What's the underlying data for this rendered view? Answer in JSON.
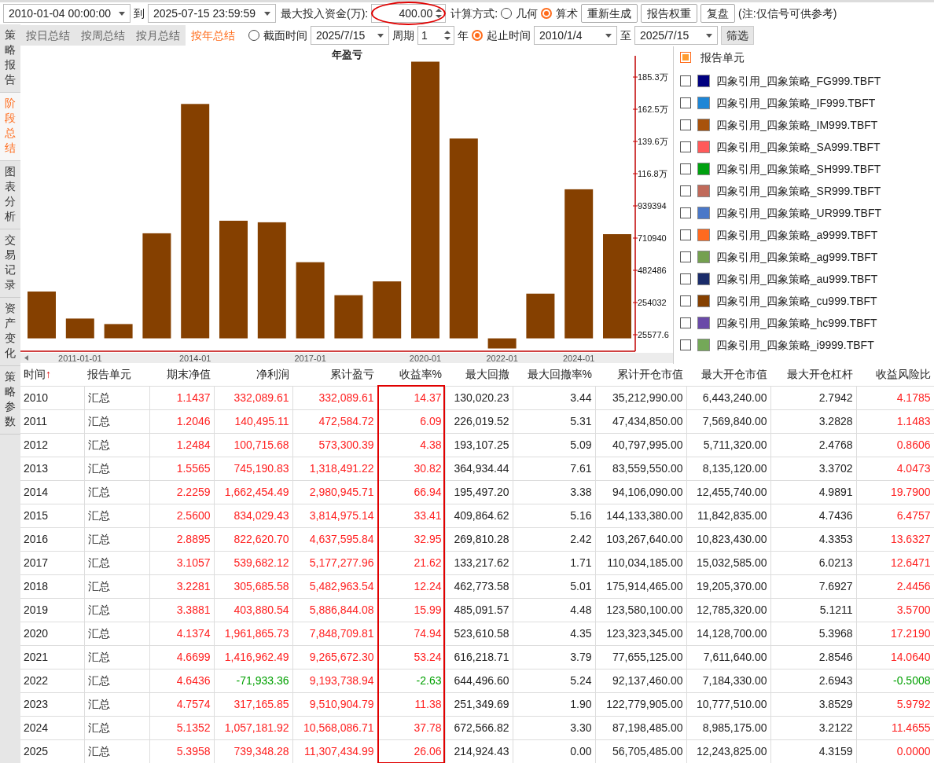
{
  "toolbar": {
    "start_time": "2010-01-04 00:00:00",
    "to_label": "到",
    "end_time": "2025-07-15 23:59:59",
    "capital_label": "最大投入资金(万):",
    "capital": {
      "value": "400.00",
      "circled": true
    },
    "method_label": "计算方式:",
    "methods": [
      {
        "label": "几何",
        "selected": false
      },
      {
        "label": "算术",
        "selected": true
      }
    ],
    "buttons": [
      "重新生成",
      "报告权重",
      "复盘"
    ],
    "note": "(注:仅信号可供参考)"
  },
  "side_tabs": [
    {
      "label": "策略报告",
      "selected": false
    },
    {
      "label": "阶段总结",
      "selected": true
    },
    {
      "label": "图表分析",
      "selected": false
    },
    {
      "label": "交易记录",
      "selected": false
    },
    {
      "label": "资产变化",
      "selected": false
    },
    {
      "label": "策略参数",
      "selected": false
    }
  ],
  "period_tabs": [
    {
      "label": "按日总结",
      "selected": false
    },
    {
      "label": "按周总结",
      "selected": false
    },
    {
      "label": "按月总结",
      "selected": false
    },
    {
      "label": "按年总结",
      "selected": true
    }
  ],
  "filter": {
    "snapshot": {
      "label": "截面时间",
      "selected": false
    },
    "snapshot_date": "2025/7/15",
    "period_label": "周期",
    "period": "1",
    "unit_label": "年",
    "range": {
      "label": "起止时间",
      "selected": true
    },
    "range_start": "2010/1/4",
    "range_to": "至",
    "range_end": "2025/7/15",
    "button": "筛选"
  },
  "chart_data": {
    "type": "bar",
    "title": "年盈亏",
    "categories": [
      null,
      "2011-01-01",
      null,
      null,
      "2014-01",
      null,
      null,
      "2017-01",
      null,
      null,
      "2020-01",
      null,
      "2022-01",
      null,
      "2024-01",
      null
    ],
    "series": [
      {
        "color": "#854000",
        "values": [
          332000,
          140000,
          101000,
          745000,
          1662000,
          834000,
          823000,
          540000,
          306000,
          404000,
          1962000,
          1417000,
          -72000,
          317000,
          1057000,
          739000
        ]
      }
    ],
    "ylim": [
      -86000,
      1976000
    ],
    "yticks": [
      {
        "value": 25577.6,
        "label": "25577.6"
      },
      {
        "value": 254032,
        "label": "254032"
      },
      {
        "value": 482486,
        "label": "482486"
      },
      {
        "value": 710940,
        "label": "710940"
      },
      {
        "value": 939394,
        "label": "939394"
      }
    ]
  },
  "chart_upper_tick_labels": [
    "185.3万",
    "162.5万",
    "139.6万",
    "116.8万"
  ],
  "legend": {
    "header": "报告单元",
    "header_partial": true,
    "items": [
      {
        "label": "四象引用_四象策略_FG999.TBFT",
        "color": "#000080",
        "checked": false
      },
      {
        "label": "四象引用_四象策略_IF999.TBFT",
        "color": "#1e86d6",
        "checked": false
      },
      {
        "label": "四象引用_四象策略_IM999.TBFT",
        "color": "#a8520c",
        "checked": false
      },
      {
        "label": "四象引用_四象策略_SA999.TBFT",
        "color": "#ff5a5a",
        "checked": false
      },
      {
        "label": "四象引用_四象策略_SH999.TBFT",
        "color": "#00a010",
        "checked": false
      },
      {
        "label": "四象引用_四象策略_SR999.TBFT",
        "color": "#c06a5a",
        "checked": false
      },
      {
        "label": "四象引用_四象策略_UR999.TBFT",
        "color": "#4a78c8",
        "checked": false
      },
      {
        "label": "四象引用_四象策略_a9999.TBFT",
        "color": "#ff6a20",
        "checked": false
      },
      {
        "label": "四象引用_四象策略_ag999.TBFT",
        "color": "#74a050",
        "checked": false
      },
      {
        "label": "四象引用_四象策略_au999.TBFT",
        "color": "#1a2c6a",
        "checked": false
      },
      {
        "label": "四象引用_四象策略_cu999.TBFT",
        "color": "#854000",
        "checked": false
      },
      {
        "label": "四象引用_四象策略_hc999.TBFT",
        "color": "#6a4aa8",
        "checked": false
      },
      {
        "label": "四象引用_四象策略_i9999.TBFT",
        "color": "#74a858",
        "checked": false
      }
    ]
  },
  "table": {
    "columns": [
      {
        "label": "时间",
        "sort_mark": "↑",
        "kind": "plain",
        "highlighted": false
      },
      {
        "label": "报告单元",
        "kind": "plain",
        "highlighted": false
      },
      {
        "label": "期末净值",
        "kind": "gain",
        "highlighted": false
      },
      {
        "label": "净利润",
        "kind": "pnl",
        "highlighted": false
      },
      {
        "label": "累计盈亏",
        "kind": "gain",
        "highlighted": false
      },
      {
        "label": "收益率%",
        "kind": "pnl",
        "highlighted": true
      },
      {
        "label": "最大回撤",
        "kind": "plain",
        "highlighted": false
      },
      {
        "label": "最大回撤率%",
        "kind": "plain",
        "highlighted": false
      },
      {
        "label": "累计开仓市值",
        "kind": "plain",
        "highlighted": false
      },
      {
        "label": "最大开仓市值",
        "kind": "plain",
        "highlighted": false
      },
      {
        "label": "最大开仓杠杆",
        "kind": "plain",
        "highlighted": false
      },
      {
        "label": "收益风险比",
        "kind": "pnl",
        "highlighted": false
      }
    ],
    "rows": [
      {
        "loss": false,
        "cells": [
          "2010",
          "汇总",
          "1.1437",
          "332,089.61",
          "332,089.61",
          "14.37",
          "130,020.23",
          "3.44",
          "35,212,990.00",
          "6,443,240.00",
          "2.7942",
          "4.1785"
        ]
      },
      {
        "loss": false,
        "cells": [
          "2011",
          "汇总",
          "1.2046",
          "140,495.11",
          "472,584.72",
          "6.09",
          "226,019.52",
          "5.31",
          "47,434,850.00",
          "7,569,840.00",
          "3.2828",
          "1.1483"
        ]
      },
      {
        "loss": false,
        "cells": [
          "2012",
          "汇总",
          "1.2484",
          "100,715.68",
          "573,300.39",
          "4.38",
          "193,107.25",
          "5.09",
          "40,797,995.00",
          "5,711,320.00",
          "2.4768",
          "0.8606"
        ]
      },
      {
        "loss": false,
        "cells": [
          "2013",
          "汇总",
          "1.5565",
          "745,190.83",
          "1,318,491.22",
          "30.82",
          "364,934.44",
          "7.61",
          "83,559,550.00",
          "8,135,120.00",
          "3.3702",
          "4.0473"
        ]
      },
      {
        "loss": false,
        "cells": [
          "2014",
          "汇总",
          "2.2259",
          "1,662,454.49",
          "2,980,945.71",
          "66.94",
          "195,497.20",
          "3.38",
          "94,106,090.00",
          "12,455,740.00",
          "4.9891",
          "19.7900"
        ]
      },
      {
        "loss": false,
        "cells": [
          "2015",
          "汇总",
          "2.5600",
          "834,029.43",
          "3,814,975.14",
          "33.41",
          "409,864.62",
          "5.16",
          "144,133,380.00",
          "11,842,835.00",
          "4.7436",
          "6.4757"
        ]
      },
      {
        "loss": false,
        "cells": [
          "2016",
          "汇总",
          "2.8895",
          "822,620.70",
          "4,637,595.84",
          "32.95",
          "269,810.28",
          "2.42",
          "103,267,640.00",
          "10,823,430.00",
          "4.3353",
          "13.6327"
        ]
      },
      {
        "loss": false,
        "cells": [
          "2017",
          "汇总",
          "3.1057",
          "539,682.12",
          "5,177,277.96",
          "21.62",
          "133,217.62",
          "1.71",
          "110,034,185.00",
          "15,032,585.00",
          "6.0213",
          "12.6471"
        ]
      },
      {
        "loss": false,
        "cells": [
          "2018",
          "汇总",
          "3.2281",
          "305,685.58",
          "5,482,963.54",
          "12.24",
          "462,773.58",
          "5.01",
          "175,914,465.00",
          "19,205,370.00",
          "7.6927",
          "2.4456"
        ]
      },
      {
        "loss": false,
        "cells": [
          "2019",
          "汇总",
          "3.3881",
          "403,880.54",
          "5,886,844.08",
          "15.99",
          "485,091.57",
          "4.48",
          "123,580,100.00",
          "12,785,320.00",
          "5.1211",
          "3.5700"
        ]
      },
      {
        "loss": false,
        "cells": [
          "2020",
          "汇总",
          "4.1374",
          "1,961,865.73",
          "7,848,709.81",
          "74.94",
          "523,610.58",
          "4.35",
          "123,323,345.00",
          "14,128,700.00",
          "5.3968",
          "17.2190"
        ]
      },
      {
        "loss": false,
        "cells": [
          "2021",
          "汇总",
          "4.6699",
          "1,416,962.49",
          "9,265,672.30",
          "53.24",
          "616,218.71",
          "3.79",
          "77,655,125.00",
          "7,611,640.00",
          "2.8546",
          "14.0640"
        ]
      },
      {
        "loss": true,
        "cells": [
          "2022",
          "汇总",
          "4.6436",
          "-71,933.36",
          "9,193,738.94",
          "-2.63",
          "644,496.60",
          "5.24",
          "92,137,460.00",
          "7,184,330.00",
          "2.6943",
          "-0.5008"
        ]
      },
      {
        "loss": false,
        "cells": [
          "2023",
          "汇总",
          "4.7574",
          "317,165.85",
          "9,510,904.79",
          "11.38",
          "251,349.69",
          "1.90",
          "122,779,905.00",
          "10,777,510.00",
          "3.8529",
          "5.9792"
        ]
      },
      {
        "loss": false,
        "cells": [
          "2024",
          "汇总",
          "5.1352",
          "1,057,181.92",
          "10,568,086.71",
          "37.78",
          "672,566.82",
          "3.30",
          "87,198,485.00",
          "8,985,175.00",
          "3.2122",
          "11.4655"
        ]
      },
      {
        "loss": false,
        "cells": [
          "2025",
          "汇总",
          "5.3958",
          "739,348.28",
          "11,307,434.99",
          "26.06",
          "214,924.43",
          "0.00",
          "56,705,485.00",
          "12,243,825.00",
          "4.3159",
          "0.0000"
        ]
      }
    ]
  }
}
